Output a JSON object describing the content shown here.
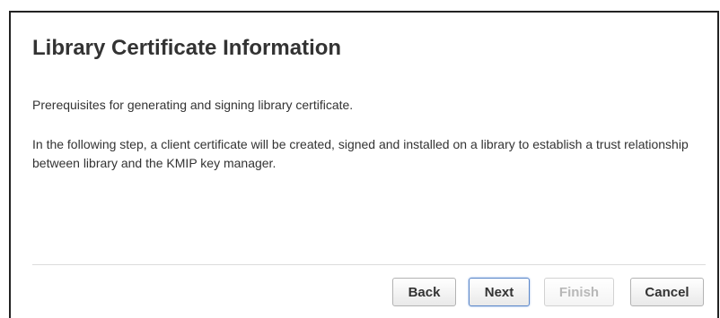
{
  "dialog": {
    "title": "Library Certificate Information",
    "paragraphs": [
      "Prerequisites for generating and signing library certificate.",
      "In the following step, a client certificate will be created, signed and installed on a library to establish a trust relationship between library and the KMIP key manager."
    ]
  },
  "footer": {
    "back_label": "Back",
    "next_label": "Next",
    "finish_label": "Finish",
    "cancel_label": "Cancel"
  }
}
